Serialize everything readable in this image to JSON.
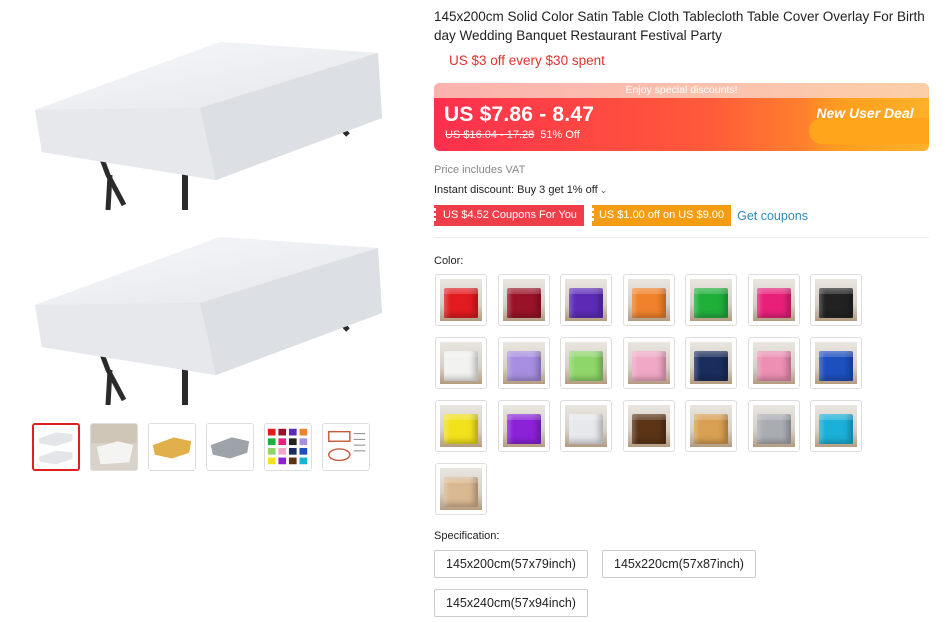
{
  "product": {
    "title": "145x200cm Solid Color Satin Table Cloth Tablecloth Table Cover Overlay For Birthday Wedding Banquet Restaurant Festival Party",
    "store_promo": "US $3 off every $30 spent"
  },
  "price": {
    "ribbon": "Enjoy special discounts!",
    "current": "US $7.86 - 8.47",
    "original": "US $16.04 - 17.28",
    "discount": "51% Off",
    "new_user_deal": "New User Deal"
  },
  "vat_note": "Price includes VAT",
  "instant_discount": {
    "label": "Instant discount: Buy 3 get 1% off",
    "chevron": "chevron-down-icon"
  },
  "coupons": {
    "coupon_1": "US $4.52 Coupons For You",
    "coupon_2": "US $1.00 off on US $9.00",
    "get_coupons": "Get coupons"
  },
  "color": {
    "label": "Color:",
    "options": [
      {
        "name": "red",
        "hex": "#e21b1f"
      },
      {
        "name": "burgundy",
        "hex": "#9a1228"
      },
      {
        "name": "purple",
        "hex": "#5b2bb5"
      },
      {
        "name": "orange",
        "hex": "#f0822b"
      },
      {
        "name": "green",
        "hex": "#1fb03a"
      },
      {
        "name": "rose",
        "hex": "#ea1f7a"
      },
      {
        "name": "black",
        "hex": "#222222"
      },
      {
        "name": "white",
        "hex": "#f2f2f0"
      },
      {
        "name": "lavender",
        "hex": "#a78ee0"
      },
      {
        "name": "light-green",
        "hex": "#8fd66a"
      },
      {
        "name": "pink",
        "hex": "#f0a8c6"
      },
      {
        "name": "navy",
        "hex": "#1a2d5c"
      },
      {
        "name": "light-pink",
        "hex": "#ec8fb2"
      },
      {
        "name": "royal-blue",
        "hex": "#1d4fbf"
      },
      {
        "name": "yellow",
        "hex": "#f2e21c"
      },
      {
        "name": "violet",
        "hex": "#8b22d8"
      },
      {
        "name": "silver-white",
        "hex": "#e6e8ec"
      },
      {
        "name": "brown",
        "hex": "#5b3416"
      },
      {
        "name": "gold",
        "hex": "#d8a052"
      },
      {
        "name": "silver",
        "hex": "#a9adb2"
      },
      {
        "name": "turquoise",
        "hex": "#1bb0d8"
      },
      {
        "name": "champagne",
        "hex": "#d9b991"
      }
    ]
  },
  "specification": {
    "label": "Specification:",
    "options": [
      "145x200cm(57x79inch)",
      "145x220cm(57x87inch)",
      "145x240cm(57x94inch)"
    ]
  },
  "gallery": {
    "thumbnails": [
      "two-white-tables",
      "white-table-room",
      "gold-table",
      "silver-table",
      "color-chart",
      "size-chart"
    ],
    "active_index": 0
  }
}
